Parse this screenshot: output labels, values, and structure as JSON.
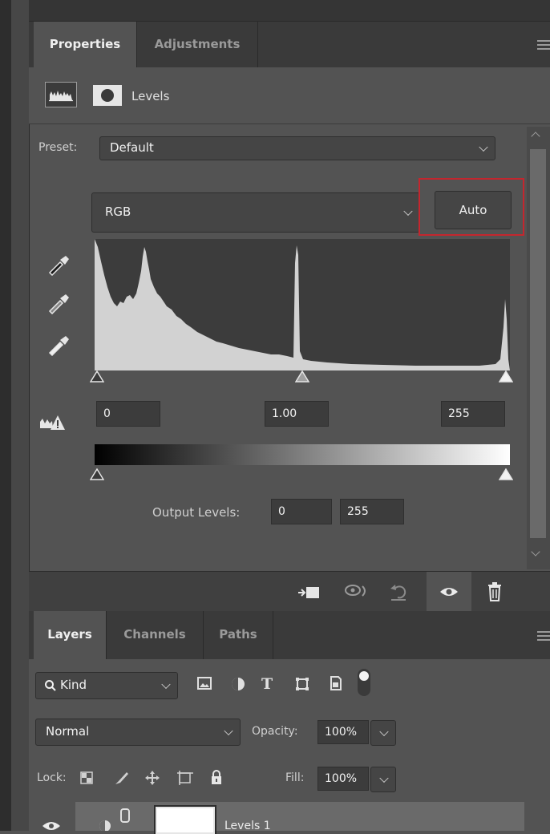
{
  "properties_panel": {
    "tabs": [
      {
        "label": "Properties",
        "active": true
      },
      {
        "label": "Adjustments",
        "active": false
      }
    ],
    "header": {
      "title": "Levels"
    },
    "preset": {
      "label": "Preset:",
      "value": "Default"
    },
    "channel": {
      "value": "RGB"
    },
    "auto_label": "Auto",
    "input_levels": {
      "black": "0",
      "gamma": "1.00",
      "white": "255"
    },
    "output_levels": {
      "label": "Output Levels:",
      "black": "0",
      "white": "255"
    }
  },
  "layers_panel": {
    "tabs": [
      {
        "label": "Layers",
        "active": true
      },
      {
        "label": "Channels",
        "active": false
      },
      {
        "label": "Paths",
        "active": false
      }
    ],
    "filter": {
      "value": "Kind"
    },
    "blend_mode": "Normal",
    "opacity": {
      "label": "Opacity:",
      "value": "100%"
    },
    "lock": {
      "label": "Lock:"
    },
    "fill": {
      "label": "Fill:",
      "value": "100%"
    },
    "layer": {
      "name": "Levels 1"
    }
  },
  "colors": {
    "accent_highlight": "#c4262e",
    "panel_bg": "#535353"
  }
}
